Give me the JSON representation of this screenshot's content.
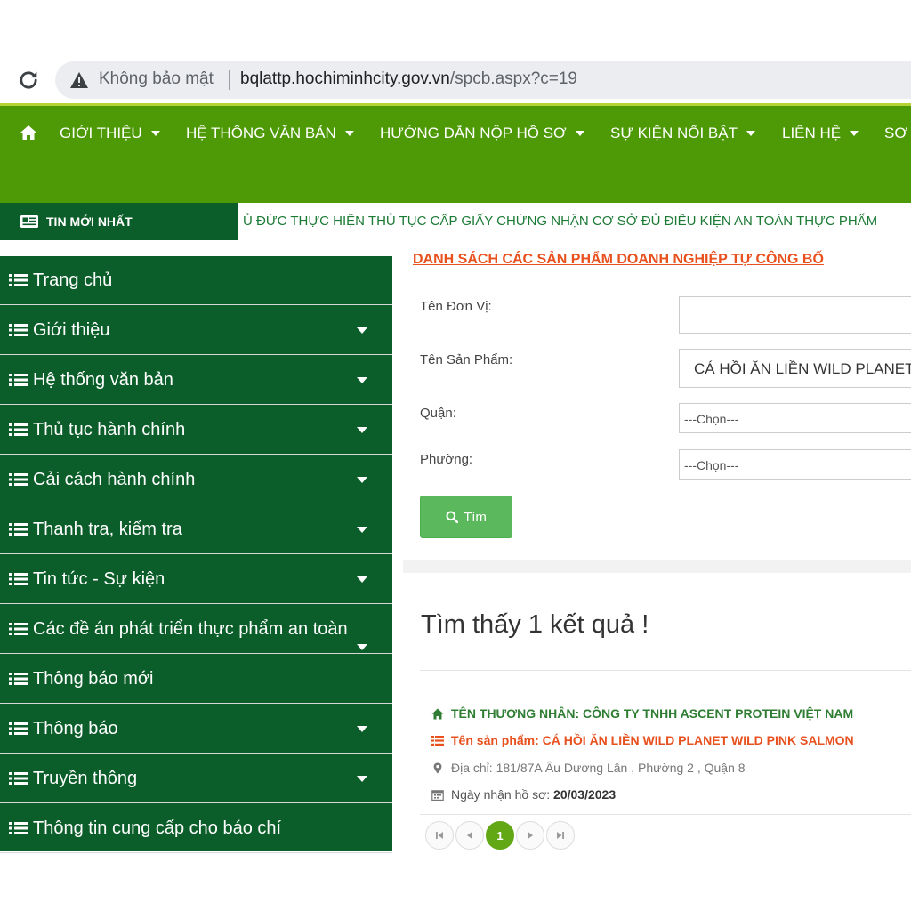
{
  "browser": {
    "secure_label": "Không bảo mật",
    "url_host": "bqlattp.hochiminhcity.gov.vn",
    "url_path": "/spcb.aspx?c=19"
  },
  "topnav": {
    "items": [
      {
        "label": "GIỚI THIỆU"
      },
      {
        "label": "HỆ THỐNG VĂN BẢN"
      },
      {
        "label": "HƯỚNG DẪN NỘP HỒ SƠ"
      },
      {
        "label": "SỰ KIỆN NỔI BẬT"
      },
      {
        "label": "LIÊN HỆ"
      },
      {
        "label": "SƠ"
      }
    ]
  },
  "news": {
    "label": "TIN MỚI NHẤT",
    "ticker": "Ủ ĐỨC THỰC HIỆN THỦ TỤC CẤP GIẤY CHỨNG NHẬN CƠ SỞ ĐỦ ĐIỀU KIỆN AN TOÀN THỰC PHẨM"
  },
  "sidebar": {
    "items": [
      {
        "label": "Trang chủ"
      },
      {
        "label": "Giới thiệu"
      },
      {
        "label": "Hệ thống văn bản"
      },
      {
        "label": "Thủ tục hành chính"
      },
      {
        "label": "Cải cách hành chính"
      },
      {
        "label": "Thanh tra, kiểm tra"
      },
      {
        "label": "Tin tức - Sự kiện"
      },
      {
        "label": "Các đề án phát triển thực phẩm an toàn"
      },
      {
        "label": "Thông báo mới"
      },
      {
        "label": "Thông báo"
      },
      {
        "label": "Truyền thông"
      },
      {
        "label": "Thông tin cung cấp cho báo chí"
      }
    ]
  },
  "search": {
    "title": "DANH SÁCH CÁC SẢN PHẨM DOANH NGHIỆP TỰ CÔNG BỐ",
    "unit_label": "Tên Đơn Vị:",
    "unit_value": "",
    "product_label": "Tên Sản Phẩm:",
    "product_value": "CÁ HỒI ĂN LIỀN WILD PLANET",
    "district_label": "Quận:",
    "district_value": "---Chọn---",
    "ward_label": "Phường:",
    "ward_value": "---Chọn---",
    "button_label": "Tìm"
  },
  "results": {
    "count_text": "Tìm thấy 1 kết quả !",
    "items": [
      {
        "merchant": "TÊN THƯƠNG NHÂN: CÔNG TY TNHH ASCENT PROTEIN VIỆT NAM",
        "product": "Tên sản phẩm: CÁ HỒI ĂN LIỀN WILD PLANET WILD PINK SALMON",
        "address": "Địa chỉ: 181/87A Âu Dương Lân , Phường 2 , Quận 8",
        "received_label": "Ngày nhận hồ sơ:",
        "received_date": "20/03/2023"
      }
    ]
  },
  "pagination": {
    "current_page": "1"
  },
  "colors": {
    "topnav_bg": "#4e9a06",
    "sidebar_bg": "#0b5e2a",
    "title_accent": "#e8501e",
    "button_green": "#5cb85c",
    "merchant_green": "#2e7d32"
  }
}
